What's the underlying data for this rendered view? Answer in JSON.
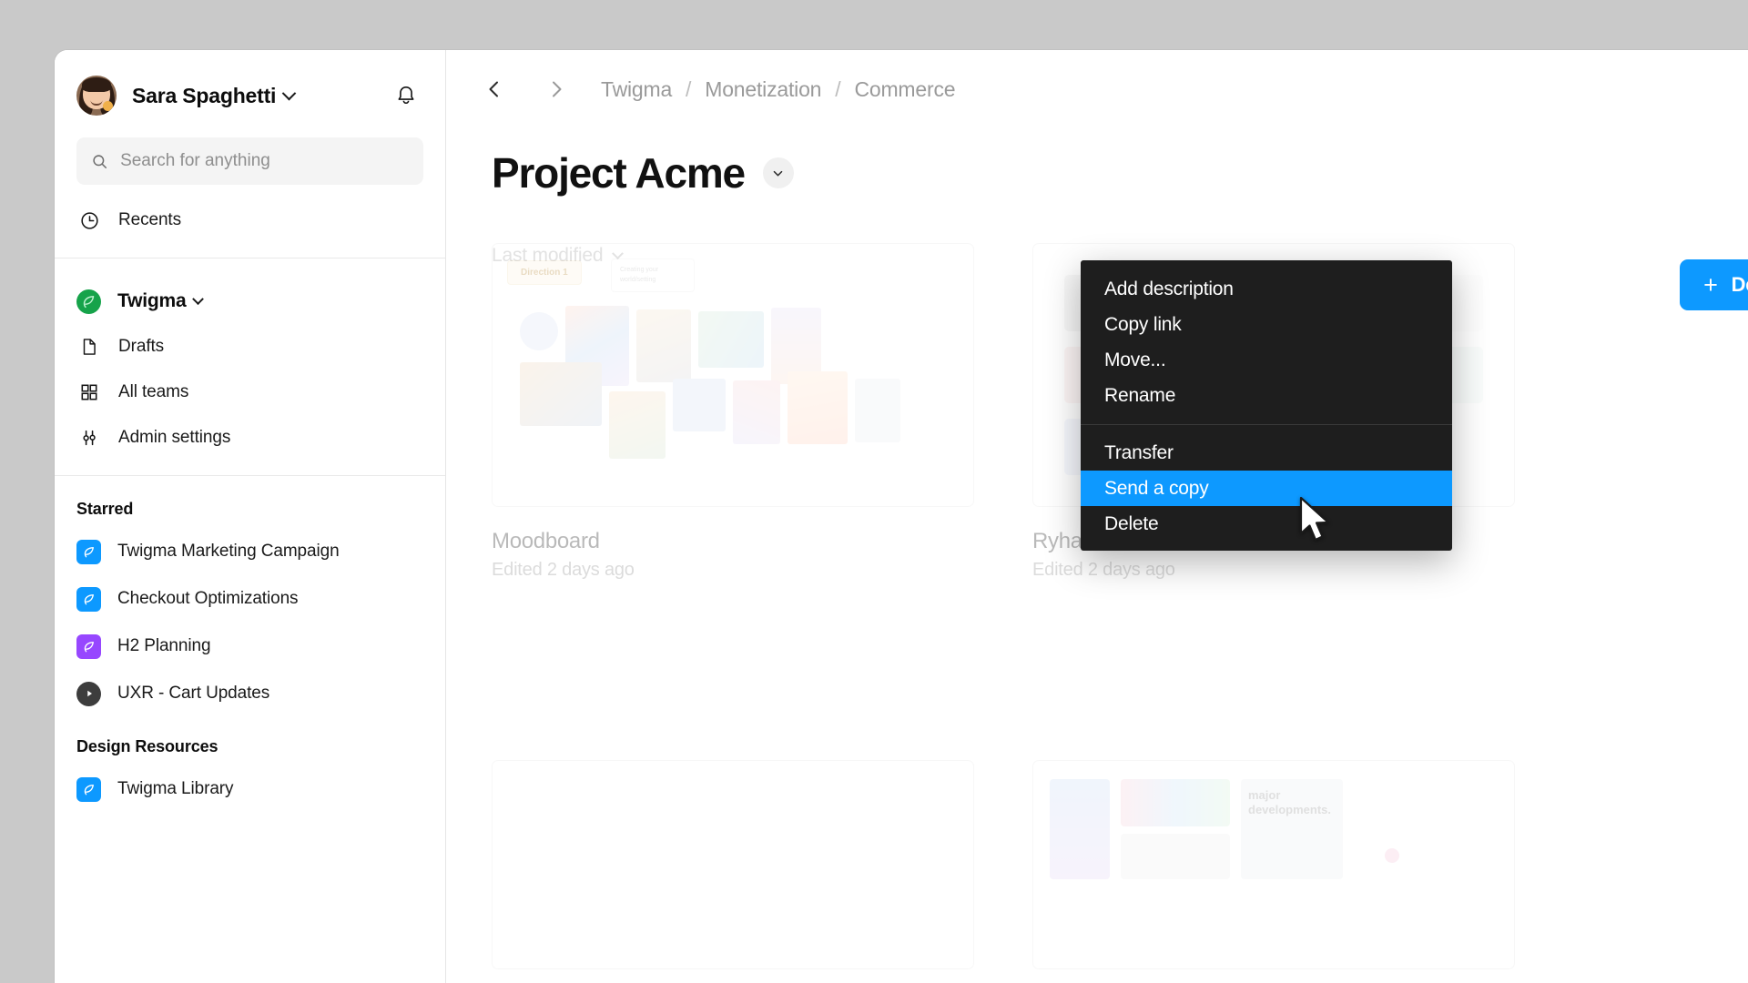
{
  "user": {
    "name": "Sara Spaghetti",
    "avatar_alt": "user-avatar"
  },
  "search": {
    "placeholder": "Search for anything",
    "value": ""
  },
  "sidebar": {
    "recents_label": "Recents",
    "team": {
      "name": "Twigma"
    },
    "nav_items": [
      {
        "label": "Drafts",
        "icon": "file-icon"
      },
      {
        "label": "All teams",
        "icon": "grid-icon"
      },
      {
        "label": "Admin settings",
        "icon": "sliders-icon"
      }
    ],
    "starred": {
      "title": "Starred",
      "items": [
        {
          "label": "Twigma Marketing Campaign",
          "icon": "twigma-file-icon",
          "color": "#0D99FF"
        },
        {
          "label": "Checkout Optimizations",
          "icon": "twigma-file-icon",
          "color": "#0D99FF"
        },
        {
          "label": "H2 Planning",
          "icon": "twigma-file-icon",
          "color": "#9747FF"
        },
        {
          "label": "UXR - Cart Updates",
          "icon": "play-icon",
          "color": "#3d3d3d"
        }
      ]
    },
    "design_resources": {
      "title": "Design Resources",
      "items": [
        {
          "label": "Twigma Library",
          "icon": "twigma-file-icon",
          "color": "#0D99FF"
        }
      ]
    }
  },
  "header": {
    "breadcrumb": [
      "Twigma",
      "Monetization",
      "Commerce"
    ],
    "breadcrumb_separator": "/",
    "back_icon": "chevron-left-icon",
    "forward_icon": "chevron-right-icon",
    "bell_icon": "bell-icon"
  },
  "page": {
    "title": "Project Acme",
    "title_caret_icon": "chevron-down-icon",
    "sort_label": "Last modified",
    "design_button_label": "Design f"
  },
  "cards": [
    {
      "name": "Moodboard",
      "meta": "Edited 2 days ago",
      "tag": "Direction 1",
      "note": "Creating your world/setting"
    },
    {
      "name": "Ryhan's Team Colors",
      "meta": "Edited 2 days ago"
    }
  ],
  "context_menu": {
    "group_one": [
      "Add description",
      "Copy link",
      "Move...",
      "Rename"
    ],
    "group_two": [
      "Transfer",
      "Send a copy",
      "Delete"
    ],
    "highlighted": "Send a copy",
    "highlight_color": "#0D99FF",
    "background_color": "#1e1e1e"
  },
  "colors": {
    "accent": "#0D99FF",
    "team_green": "#16A34A",
    "purple": "#9747FF",
    "desktop": "#c9c9c9"
  }
}
